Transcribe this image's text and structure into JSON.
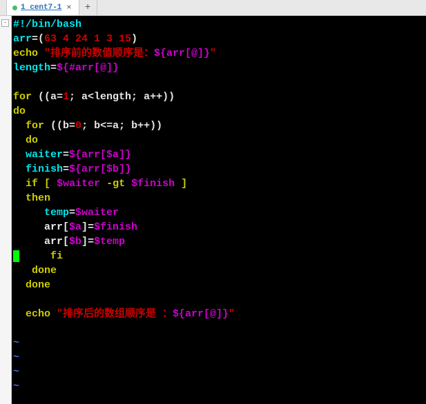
{
  "tabs": {
    "active_title": "1 cent7-1",
    "add_label": "+",
    "close_label": "×"
  },
  "gutter": {
    "collapse": "-"
  },
  "code": {
    "l1_shebang": "#!/bin/bash",
    "l2_var": "arr",
    "l2_eq": "=(",
    "l2_vals": "63 4 24 1 3 15",
    "l2_close": ")",
    "l3_echo": "echo",
    "l3_str_a": " \"排序前的数值顺序是：",
    "l3_exp": "${arr[@]}",
    "l3_str_b": "\"",
    "l4_var": "length",
    "l4_eq": "=",
    "l4_exp": "${#arr[@]}",
    "l6_for": "for",
    "l6_a": " ((a=",
    "l6_one": "1",
    "l6_b": "; a<length; a++))",
    "l7_do": "do",
    "l8_ind": "  ",
    "l8_for": "for",
    "l8_a": " ((b=",
    "l8_zero": "0",
    "l8_b": "; b<=a; b++))",
    "l9_ind": "  ",
    "l9_do": "do",
    "l10_ind": "  ",
    "l10_var": "waiter",
    "l10_eq": "=",
    "l10_exp": "${arr[$a]}",
    "l11_ind": "  ",
    "l11_var": "finish",
    "l11_eq": "=",
    "l11_exp": "${arr[$b]}",
    "l12_ind": "  ",
    "l12_if": "if",
    "l12_sp": " ",
    "l12_br1": "[",
    "l12_w": " $waiter ",
    "l12_gt": "-gt",
    "l12_f": " $finish ",
    "l12_br2": "]",
    "l13_ind": "  ",
    "l13_then": "then",
    "l14_ind": "     ",
    "l14_var": "temp",
    "l14_eq": "=",
    "l14_w": "$waiter",
    "l15_ind": "     arr[",
    "l15_a": "$a",
    "l15_mid": "]=",
    "l15_f": "$finish",
    "l16_ind": "     arr[",
    "l16_b": "$b",
    "l16_mid": "]=",
    "l16_t": "$temp",
    "l17_ind": "     ",
    "l17_fi": "fi",
    "l18_ind": "   ",
    "l18_done": "done",
    "l19_ind": "  ",
    "l19_done": "done",
    "l21_ind": "  ",
    "l21_echo": "echo",
    "l21_str_a": " \"排序后的数组顺序是 ：",
    "l21_exp": "${arr[@]}",
    "l21_str_b": "\"",
    "tilde": "~"
  }
}
